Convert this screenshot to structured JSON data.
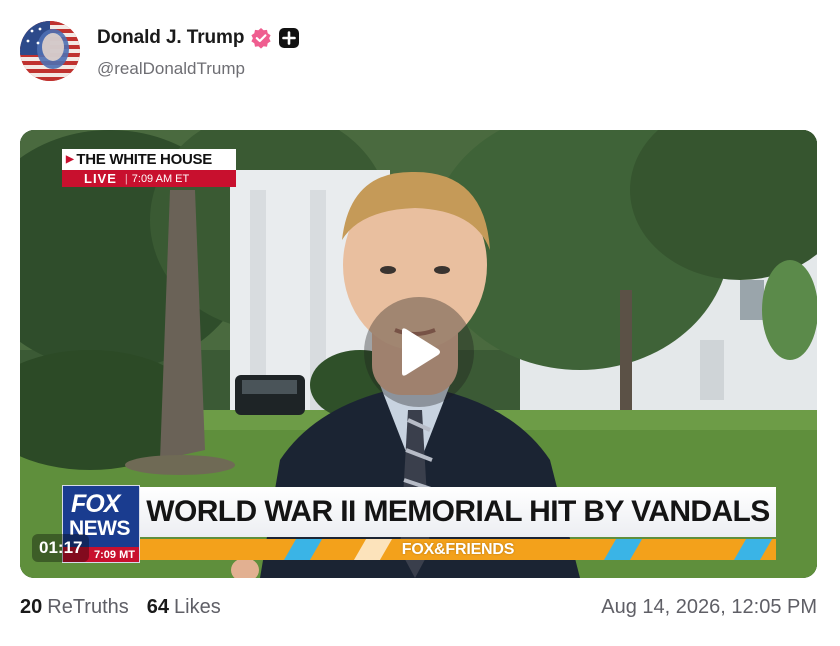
{
  "post": {
    "author": {
      "display_name": "Donald J. Trump",
      "handle": "@realDonaldTrump",
      "verified_icon": "verified-badge-icon",
      "extra_icon": "plus-badge-icon"
    },
    "video": {
      "location_bug": {
        "title": "THE WHITE HOUSE",
        "live_label": "LIVE",
        "time": "7:09 AM ET"
      },
      "chyron": {
        "logo_line1": "FOX",
        "logo_line2": "NEWS",
        "logo_time": "7:09 MT",
        "headline": "WORLD WAR II MEMORIAL HIT BY VANDALS",
        "show_name": "FOX&FRIENDS"
      },
      "duration": "01:17",
      "play_icon": "play-icon"
    },
    "stats": {
      "retruths_count": "20",
      "retruths_label": "ReTruths",
      "likes_count": "64",
      "likes_label": "Likes"
    },
    "timestamp": "Aug 14, 2026, 12:05 PM"
  },
  "colors": {
    "verified": "#ef5d8f",
    "fox_blue": "#1a3c8f",
    "fox_red": "#c8102e",
    "show_orange": "#f3a11b"
  }
}
